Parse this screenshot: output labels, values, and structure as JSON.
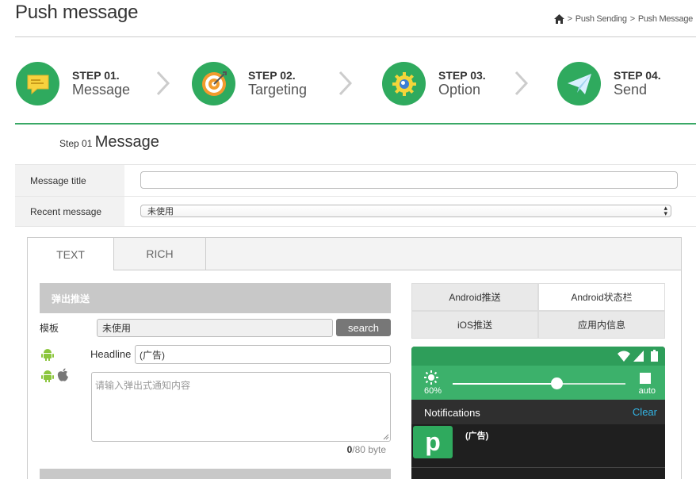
{
  "header": {
    "title": "Push message",
    "breadcrumb": {
      "sep1": ">",
      "crumb1": "Push Sending",
      "sep2": ">",
      "crumb2": "Push Message"
    }
  },
  "steps": [
    {
      "num": "STEP 01.",
      "name": "Message",
      "icon": "message-bubble-icon"
    },
    {
      "num": "STEP 02.",
      "name": "Targeting",
      "icon": "target-icon"
    },
    {
      "num": "STEP 03.",
      "name": "Option",
      "icon": "gear-icon"
    },
    {
      "num": "STEP 04.",
      "name": "Send",
      "icon": "paper-plane-icon"
    }
  ],
  "section": {
    "prefix": "Step 01",
    "title": "Message"
  },
  "form": {
    "message_title_label": "Message title",
    "message_title_value": "",
    "recent_message_label": "Recent message",
    "recent_message_value": "未使用"
  },
  "tabs": {
    "text": "TEXT",
    "rich": "RICH"
  },
  "popup": {
    "heading": "弹出推送",
    "template_label": "模板",
    "template_value": "未使用",
    "search_label": "search",
    "headline_label": "Headline",
    "headline_value": "(广告)",
    "content_placeholder": "请输入弹出式通知内容",
    "byte_used": "0",
    "byte_limit": "/80 byte"
  },
  "platform_tabs": [
    "Android推送",
    "Android状态栏",
    "iOS推送",
    "应用内信息"
  ],
  "preview": {
    "brightness_percent": "60%",
    "brightness_level": 0.6,
    "auto_label": "auto",
    "notifications_label": "Notifications",
    "clear_label": "Clear",
    "app_letter": "p",
    "notification_text": "(广告)"
  },
  "colors": {
    "accent_green": "#2faa5e",
    "step_green": "#3aa866",
    "clear_blue": "#33b5e5"
  }
}
